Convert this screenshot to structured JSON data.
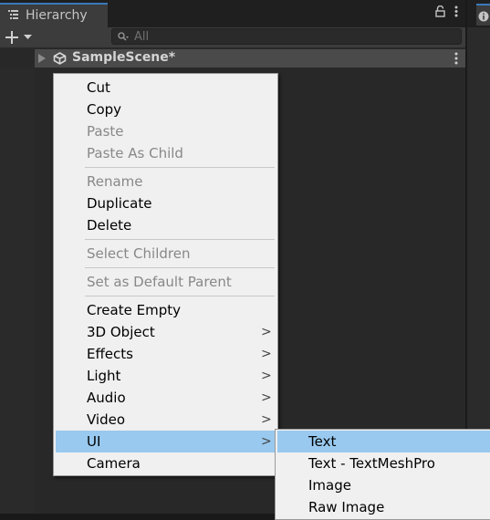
{
  "hierarchy": {
    "tab_title": "Hierarchy",
    "search_placeholder": "All",
    "scene_name": "SampleScene*"
  },
  "context_menu": {
    "items": [
      {
        "label": "Cut"
      },
      {
        "label": "Copy"
      },
      {
        "label": "Paste"
      },
      {
        "label": "Paste As Child"
      },
      {
        "label": "Rename"
      },
      {
        "label": "Duplicate"
      },
      {
        "label": "Delete"
      },
      {
        "label": "Select Children"
      },
      {
        "label": "Set as Default Parent"
      },
      {
        "label": "Create Empty"
      },
      {
        "label": "3D Object"
      },
      {
        "label": "Effects"
      },
      {
        "label": "Light"
      },
      {
        "label": "Audio"
      },
      {
        "label": "Video"
      },
      {
        "label": "UI"
      },
      {
        "label": "Camera"
      }
    ],
    "disabled_items": [
      "Paste",
      "Paste As Child",
      "Rename",
      "Select Children",
      "Set as Default Parent"
    ],
    "highlighted_item": "UI",
    "submenu_arrow_glyph": ">"
  },
  "ui_submenu": {
    "items": [
      {
        "label": "Text"
      },
      {
        "label": "Text - TextMeshPro"
      },
      {
        "label": "Image"
      },
      {
        "label": "Raw Image"
      }
    ],
    "highlighted_item": "Text"
  },
  "colors": {
    "accent_tab": "#3a79bb",
    "menu_highlight": "#99c9ef",
    "panel_bg": "#282828",
    "menu_bg": "#f0f0f0"
  }
}
